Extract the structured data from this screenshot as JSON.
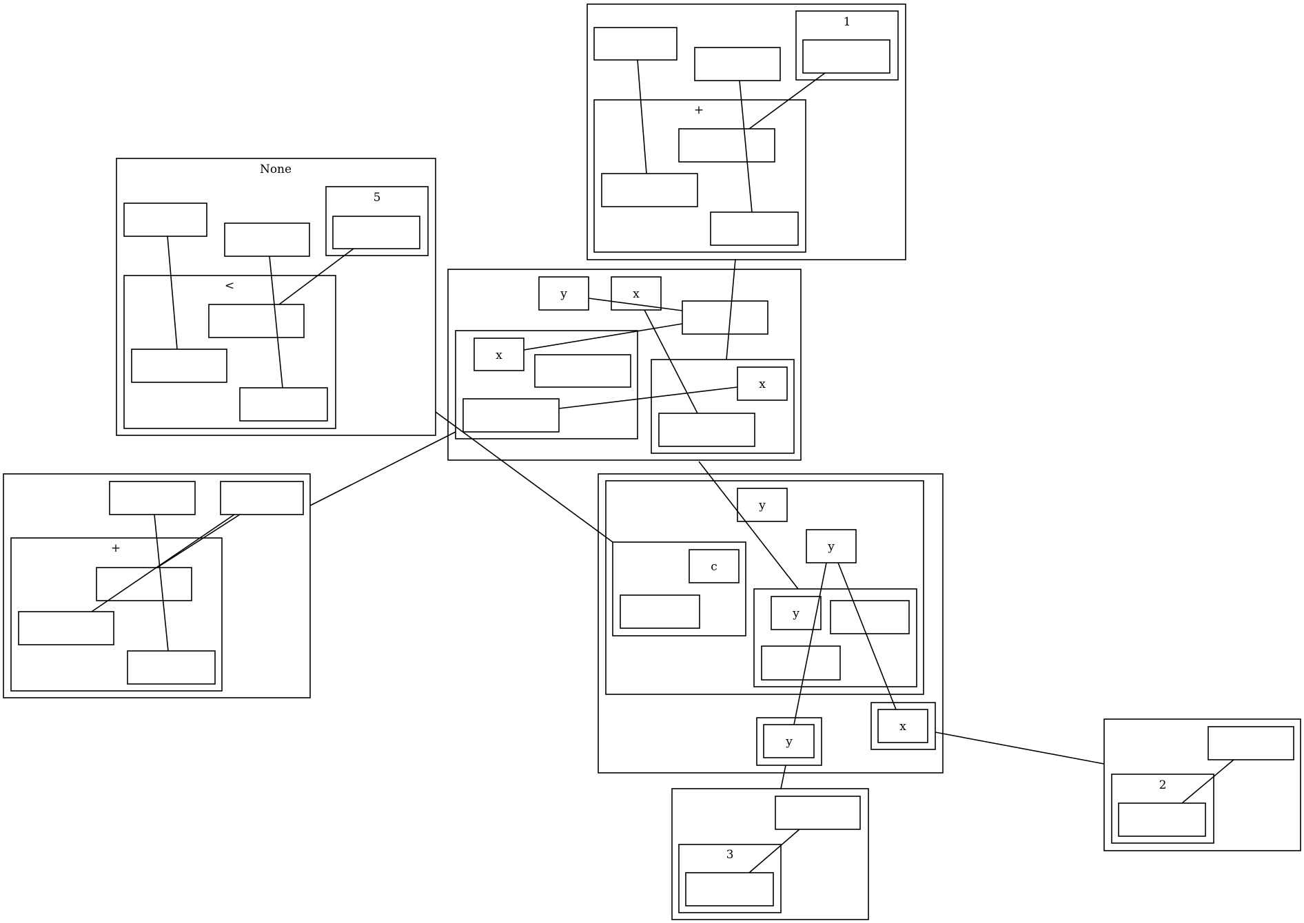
{
  "labels": {
    "none": "None",
    "five": "5",
    "lt": "<",
    "one": "1",
    "plus_top": "+",
    "plus_left": "+",
    "two": "2",
    "three": "3",
    "c": "c",
    "x": "x",
    "y": "y"
  }
}
